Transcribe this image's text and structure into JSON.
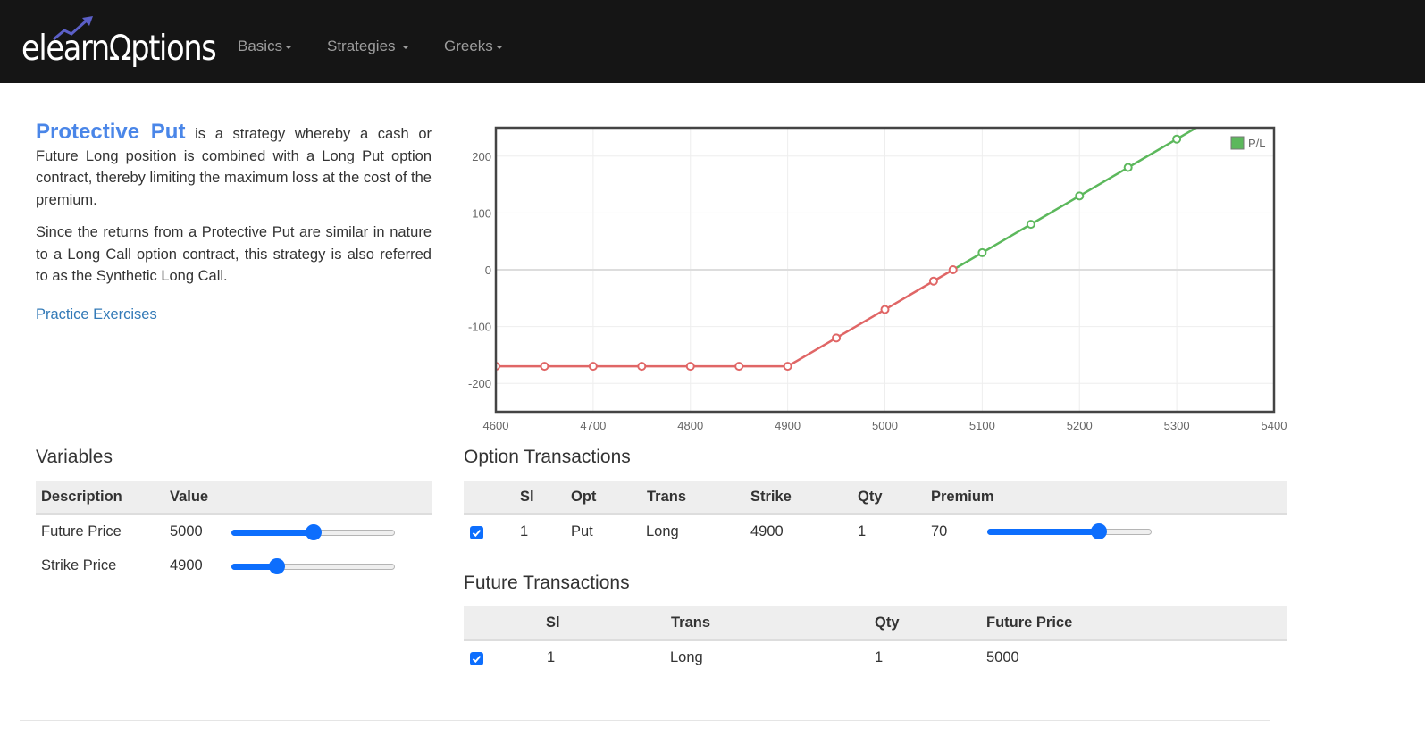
{
  "nav": {
    "logo_text": "elearnΩptions",
    "items": [
      {
        "label": "Basics"
      },
      {
        "label": "Strategies"
      },
      {
        "label": "Greeks"
      }
    ]
  },
  "description": {
    "title": "Protective Put",
    "para1_rest": " is a strategy whereby a cash or Future Long position is combined with a Long Put option contract, thereby limiting the maximum loss at the cost of the premium.",
    "para2": "Since the returns from a Protective Put are similar in nature to a Long Call option contract, this strategy is also referred to as the Synthetic Long Call.",
    "practice_link": "Practice Exercises"
  },
  "chart_data": {
    "type": "line",
    "title": "",
    "xlabel": "",
    "ylabel": "",
    "xlim": [
      4600,
      5400
    ],
    "ylim": [
      -250,
      250
    ],
    "x_ticks": [
      4600,
      4700,
      4800,
      4900,
      5000,
      5100,
      5200,
      5300,
      5400
    ],
    "y_ticks": [
      200,
      100,
      0,
      -100,
      -200
    ],
    "grid": true,
    "legend": "top-right",
    "series": [
      {
        "name": "P/L",
        "color_loss": "#e06666",
        "color_profit": "#5cb85c",
        "x": [
          4600,
          4650,
          4700,
          4750,
          4800,
          4850,
          4900,
          4950,
          5000,
          5050,
          5070,
          5100,
          5150,
          5200,
          5250,
          5300,
          5320
        ],
        "y": [
          -170,
          -170,
          -170,
          -170,
          -170,
          -170,
          -170,
          -120,
          -70,
          -20,
          0,
          30,
          80,
          130,
          180,
          230,
          250
        ],
        "markers": [
          true,
          true,
          true,
          true,
          true,
          true,
          true,
          true,
          true,
          true,
          true,
          true,
          true,
          true,
          true,
          true,
          false
        ]
      }
    ]
  },
  "variables": {
    "title": "Variables",
    "headers": [
      "Description",
      "Value"
    ],
    "rows": [
      {
        "description": "Future Price",
        "value": "5000",
        "slider_fraction": 0.5
      },
      {
        "description": "Strike Price",
        "value": "4900",
        "slider_fraction": 0.28
      }
    ]
  },
  "options": {
    "title": "Option Transactions",
    "headers": [
      "Sl",
      "Opt",
      "Trans",
      "Strike",
      "Qty",
      "Premium"
    ],
    "rows": [
      {
        "checked": true,
        "sl": "1",
        "opt": "Put",
        "trans": "Long",
        "strike": "4900",
        "qty": "1",
        "premium": "70",
        "slider_fraction": 0.68
      }
    ]
  },
  "futures": {
    "title": "Future Transactions",
    "headers": [
      "Sl",
      "Trans",
      "Qty",
      "Future Price"
    ],
    "rows": [
      {
        "checked": true,
        "sl": "1",
        "trans": "Long",
        "qty": "1",
        "future_price": "5000"
      }
    ]
  },
  "colors": {
    "accent": "#0d6efd",
    "title_blue": "#4a86e8",
    "link": "#337ab7",
    "navbar": "#151515"
  }
}
